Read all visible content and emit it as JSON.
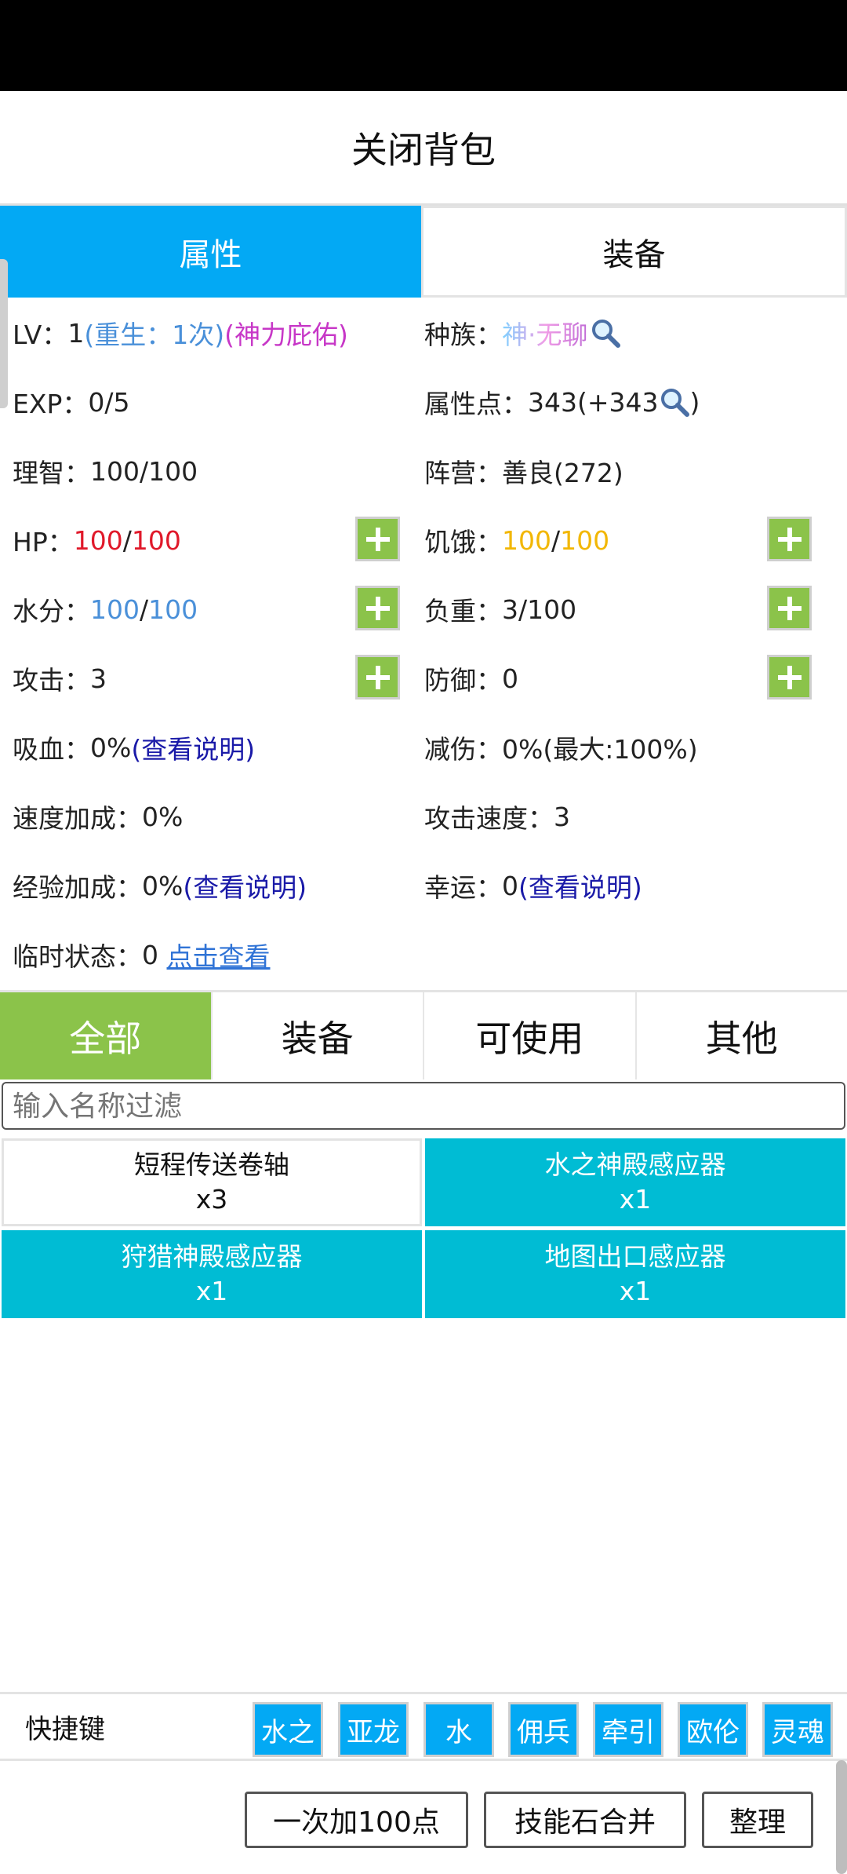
{
  "header": {
    "title": "关闭背包"
  },
  "top_tabs": [
    {
      "label": "属性",
      "active": true
    },
    {
      "label": "装备",
      "active": false
    }
  ],
  "attributes": {
    "lv": {
      "label": "LV：",
      "value": "1",
      "rebirth": "(重生：1次)",
      "blessing": "(神力庇佑)"
    },
    "race": {
      "label": "种族：",
      "value": "神·无聊",
      "icon": "magnifier-icon"
    },
    "exp": {
      "label": "EXP：",
      "value": "0/5"
    },
    "points": {
      "label": "属性点：",
      "value": "343(+343",
      "suffix": ")",
      "icon": "magnifier-icon"
    },
    "sanity": {
      "label": "理智：",
      "value": "100/100"
    },
    "faction": {
      "label": "阵营：",
      "value": "善良(272)"
    },
    "hp": {
      "label": "HP：",
      "current": "100",
      "sep": "/",
      "max": "100"
    },
    "hunger": {
      "label": "饥饿：",
      "current": "100",
      "sep": "/",
      "max": "100"
    },
    "water": {
      "label": "水分：",
      "current": "100",
      "sep": "/",
      "max": "100"
    },
    "load": {
      "label": "负重：",
      "value": "3/100"
    },
    "attack": {
      "label": "攻击：",
      "value": "3"
    },
    "defense": {
      "label": "防御：",
      "value": "0"
    },
    "lifesteal": {
      "label": "吸血：",
      "value": "0%",
      "link": "(查看说明)"
    },
    "dmg_reduce": {
      "label": "减伤：",
      "value": "0%(最大:100%)"
    },
    "speed_bonus": {
      "label": "速度加成：",
      "value": "0%"
    },
    "attack_speed": {
      "label": "攻击速度：",
      "value": "3"
    },
    "exp_bonus": {
      "label": "经验加成：",
      "value": "0%",
      "link": "(查看说明)"
    },
    "luck": {
      "label": "幸运：",
      "value": "0",
      "link": "(查看说明)"
    },
    "temp_status": {
      "label": "临时状态：",
      "value": "0",
      "link": "点击查看"
    }
  },
  "category_tabs": [
    {
      "label": "全部",
      "active": true
    },
    {
      "label": "装备",
      "active": false
    },
    {
      "label": "可使用",
      "active": false
    },
    {
      "label": "其他",
      "active": false
    }
  ],
  "filter": {
    "placeholder": "输入名称过滤"
  },
  "items": [
    {
      "name": "短程传送卷轴",
      "count": "x3"
    },
    {
      "name": "水之神殿感应器",
      "count": "x1"
    },
    {
      "name": "狩猎神殿感应器",
      "count": "x1"
    },
    {
      "name": "地图出口感应器",
      "count": "x1"
    }
  ],
  "shortcuts": {
    "label": "快捷键",
    "keys": [
      "水之",
      "亚龙",
      "水",
      "佣兵",
      "牵引",
      "欧伦",
      "灵魂"
    ]
  },
  "actions": {
    "add_points": "一次加100点",
    "merge_skill_stones": "技能石合并",
    "sort": "整理"
  },
  "colors": {
    "tab_active_blue": "#03a9f4",
    "category_active_green": "#8bc34a",
    "item_cyan": "#00bcd4",
    "hp_red": "#e0192a",
    "hunger_yellow": "#f2b705",
    "water_blue": "#4a90d9"
  }
}
